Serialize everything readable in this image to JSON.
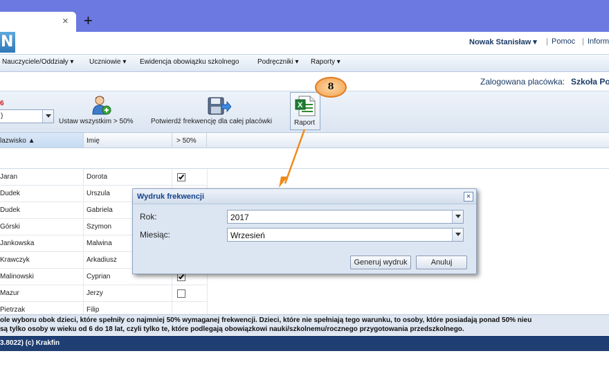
{
  "browser": {
    "tab_close": "×",
    "new_tab": "+"
  },
  "header": {
    "logo": "N",
    "user": "Nowak Stanisław ▾",
    "help": "Pomoc",
    "info": "Inform",
    "separator": "|"
  },
  "menu": [
    "Nauczyciele/Oddziały ▾",
    "Uczniowie ▾",
    "Ewidencja obowiązku szkolnego",
    "Podręczniki ▾",
    "Raporty ▾"
  ],
  "location": {
    "label": "Zalogowana placówka:",
    "value": "Szkoła Po"
  },
  "toolbar": {
    "count": "6",
    "year_value": ")",
    "set_all_label": "Ustaw wszystkim > 50%",
    "confirm_label": "Potwierdź frekwencję dla całej placówki",
    "report_label": "Raport"
  },
  "grid": {
    "columns": [
      "lazwisko ▲",
      "Imię",
      "> 50%"
    ],
    "rows": [
      {
        "surname": "Jaran",
        "name": "Dorota",
        "over50": true
      },
      {
        "surname": "Dudek",
        "name": "Urszula",
        "over50": false
      },
      {
        "surname": "Dudek",
        "name": "Gabriela",
        "over50": false
      },
      {
        "surname": "Górski",
        "name": "Szymon",
        "over50": false
      },
      {
        "surname": "Jankowska",
        "name": "Malwina",
        "over50": false
      },
      {
        "surname": "Krawczyk",
        "name": "Arkadiusz",
        "over50": false
      },
      {
        "surname": "Malinowski",
        "name": "Cyprian",
        "over50": true
      },
      {
        "surname": "Mazur",
        "name": "Jerzy",
        "over50": false
      },
      {
        "surname": "Pietrzak",
        "name": "Filip",
        "over50": false
      }
    ]
  },
  "footer": {
    "note_line1": "ole wyboru obok dzieci, które spełniły co najmniej 50% wymaganej frekwencji. Dzieci, które nie spełniają tego warunku, to osoby, które posiadają ponad 50% nieu",
    "note_line2": "są tylko osoby w wieku od 6 do 18 lat, czyli tylko te, które podlegają obowiązkowi nauki/szkolnemu/rocznego przygotowania przedszkolnego.",
    "status": "3.8022) (c) Krakfin"
  },
  "dialog": {
    "title": "Wydruk frekwencji",
    "close": "×",
    "year_label": "Rok:",
    "year_value": "2017",
    "month_label": "Miesiąc:",
    "month_value": "Wrzesień",
    "generate_label": "Generuj wydruk",
    "cancel_label": "Anuluj"
  },
  "annotation": {
    "number": "8",
    "color": "#f08a1c"
  }
}
